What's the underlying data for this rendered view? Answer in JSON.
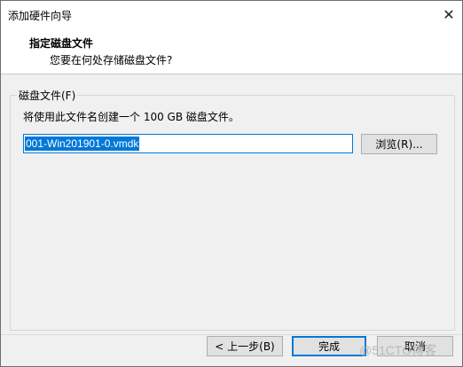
{
  "window": {
    "title": "添加硬件向导",
    "close_glyph": "✕"
  },
  "header": {
    "title": "指定磁盘文件",
    "subtitle": "您要在何处存储磁盘文件?"
  },
  "disk_file_group": {
    "legend": "磁盘文件(F)",
    "description": "将使用此文件名创建一个 100 GB 磁盘文件。",
    "filename_value": "001-Win201901-0.vmdk",
    "browse_label": "浏览(R)..."
  },
  "footer": {
    "back_label": "< 上一步(B)",
    "finish_label": "完成",
    "cancel_label": "取消"
  },
  "watermark": "@51CTO博客",
  "colors": {
    "accent": "#0078d7",
    "window_bg": "#f0f0f0",
    "button_bg": "#e1e1e1"
  }
}
